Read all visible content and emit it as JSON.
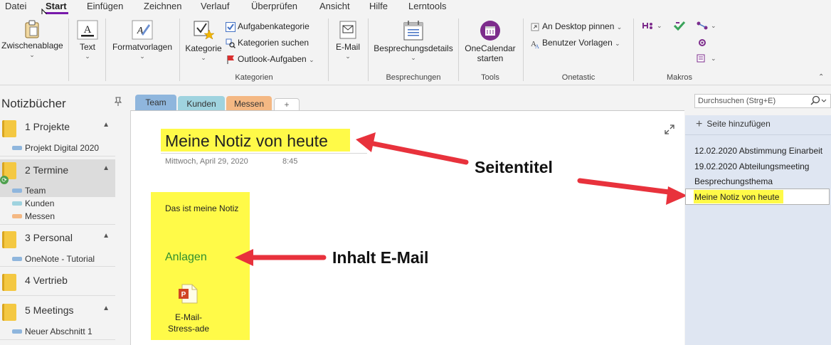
{
  "menu": {
    "tabs": [
      "Datei",
      "Start",
      "Einfügen",
      "Zeichnen",
      "Verlauf",
      "Überprüfen",
      "Ansicht",
      "Hilfe",
      "Lerntools"
    ],
    "active": "Start"
  },
  "ribbon": {
    "clipboard": "Zwischenablage",
    "text": "Text",
    "styles": "Formatvorlagen",
    "category": "Kategorie",
    "task_category": "Aufgabenkategorie",
    "search_categories": "Kategorien suchen",
    "outlook_tasks": "Outlook-Aufgaben",
    "group_categories": "Kategorien",
    "email": "E-Mail",
    "meeting_details": "Besprechungsdetails",
    "group_meetings": "Besprechungen",
    "onecalendar_line1": "OneCalendar",
    "onecalendar_line2": "starten",
    "group_tools": "Tools",
    "pin_desktop": "An Desktop pinnen",
    "user_templates": "Benutzer Vorlagen",
    "group_onetastic": "Onetastic",
    "group_macros": "Makros"
  },
  "notebooks": {
    "title": "Notizbücher",
    "items": [
      {
        "name": "1 Projekte",
        "sections": [
          "Projekt Digital 2020"
        ]
      },
      {
        "name": "2 Termine",
        "sections": [
          "Team",
          "Kunden",
          "Messen"
        ]
      },
      {
        "name": "3 Personal",
        "sections": [
          "OneNote - Tutorial"
        ]
      },
      {
        "name": "4 Vertrieb",
        "sections": []
      },
      {
        "name": "5 Meetings",
        "sections": [
          "Neuer Abschnitt 1"
        ]
      }
    ]
  },
  "section_tabs": [
    {
      "label": "Team",
      "color": "#8fb6dd"
    },
    {
      "label": "Kunden",
      "color": "#9fd3df"
    },
    {
      "label": "Messen",
      "color": "#f4b883"
    },
    {
      "label": "+",
      "color": "#ffffff"
    }
  ],
  "page": {
    "title": "Meine Notiz von heute",
    "date": "Mittwoch, April 29, 2020",
    "time": "8:45",
    "note_text": "Das ist meine Notiz",
    "attachments_heading": "Anlagen",
    "attachment_line1": "E-Mail-",
    "attachment_line2": "Stress-ade"
  },
  "annotations": {
    "title_label": "Seitentitel",
    "content_label": "Inhalt E-Mail"
  },
  "search": {
    "placeholder": "Durchsuchen (Strg+E)"
  },
  "pages_list": {
    "add_label": "Seite hinzufügen",
    "items": [
      "12.02.2020 Abstimmung Einarbeit",
      "19.02.2020 Abteilungsmeeting",
      "Besprechungsthema",
      "Meine Notiz von heute"
    ]
  },
  "colors": {
    "highlight": "#fffa48",
    "arrow": "#e8323c",
    "accent": "#7719aa"
  }
}
